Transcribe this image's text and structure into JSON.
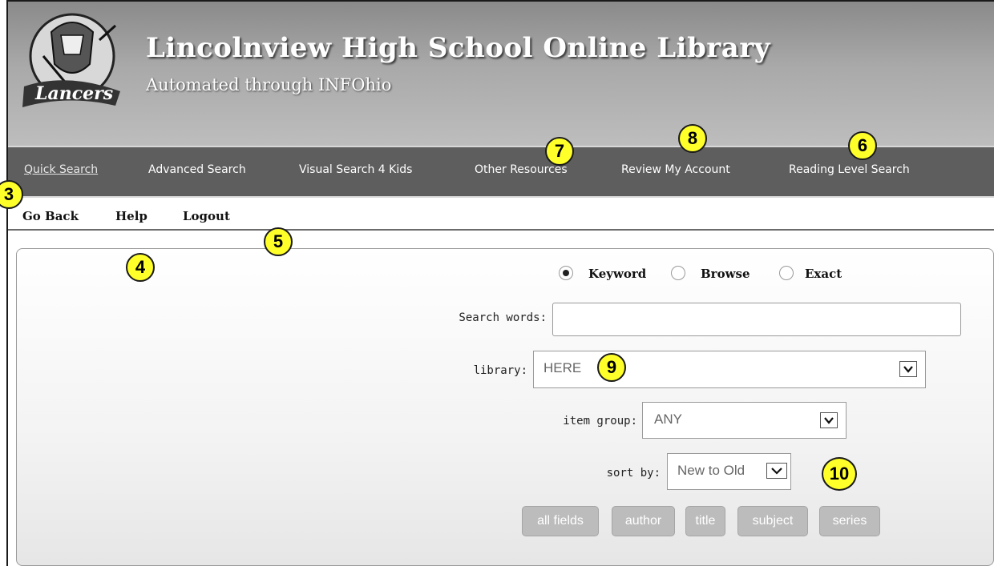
{
  "header": {
    "title": "Lincolnview High School Online Library",
    "subtitle": "Automated through INFOhio",
    "logo_text": "Lancers"
  },
  "nav": {
    "items": [
      {
        "label": "Quick Search",
        "active": true
      },
      {
        "label": "Advanced Search"
      },
      {
        "label": "Visual Search 4 Kids"
      },
      {
        "label": "Other Resources"
      },
      {
        "label": "Review My Account"
      },
      {
        "label": "Reading Level Search"
      }
    ]
  },
  "subnav": {
    "items": [
      {
        "label": "Go Back"
      },
      {
        "label": "Help"
      },
      {
        "label": "Logout"
      }
    ]
  },
  "search": {
    "modes": [
      {
        "label": "Keyword",
        "selected": true
      },
      {
        "label": "Browse",
        "selected": false
      },
      {
        "label": "Exact",
        "selected": false
      }
    ],
    "search_words_label": "Search words:",
    "search_words_value": "",
    "library_label": "library:",
    "library_value": "HERE",
    "item_group_label": "item group:",
    "item_group_value": "ANY",
    "sort_by_label": "sort by:",
    "sort_by_value": "New to Old",
    "buttons": [
      "all fields",
      "author",
      "title",
      "subject",
      "series"
    ]
  },
  "callouts": [
    "3",
    "4",
    "5",
    "6",
    "7",
    "8",
    "9",
    "10"
  ],
  "colors": {
    "header_gradient_top": "#8a8a8a",
    "navbar": "#5e5e5e",
    "callout": "#ffff29",
    "button": "#bcbcbc"
  }
}
